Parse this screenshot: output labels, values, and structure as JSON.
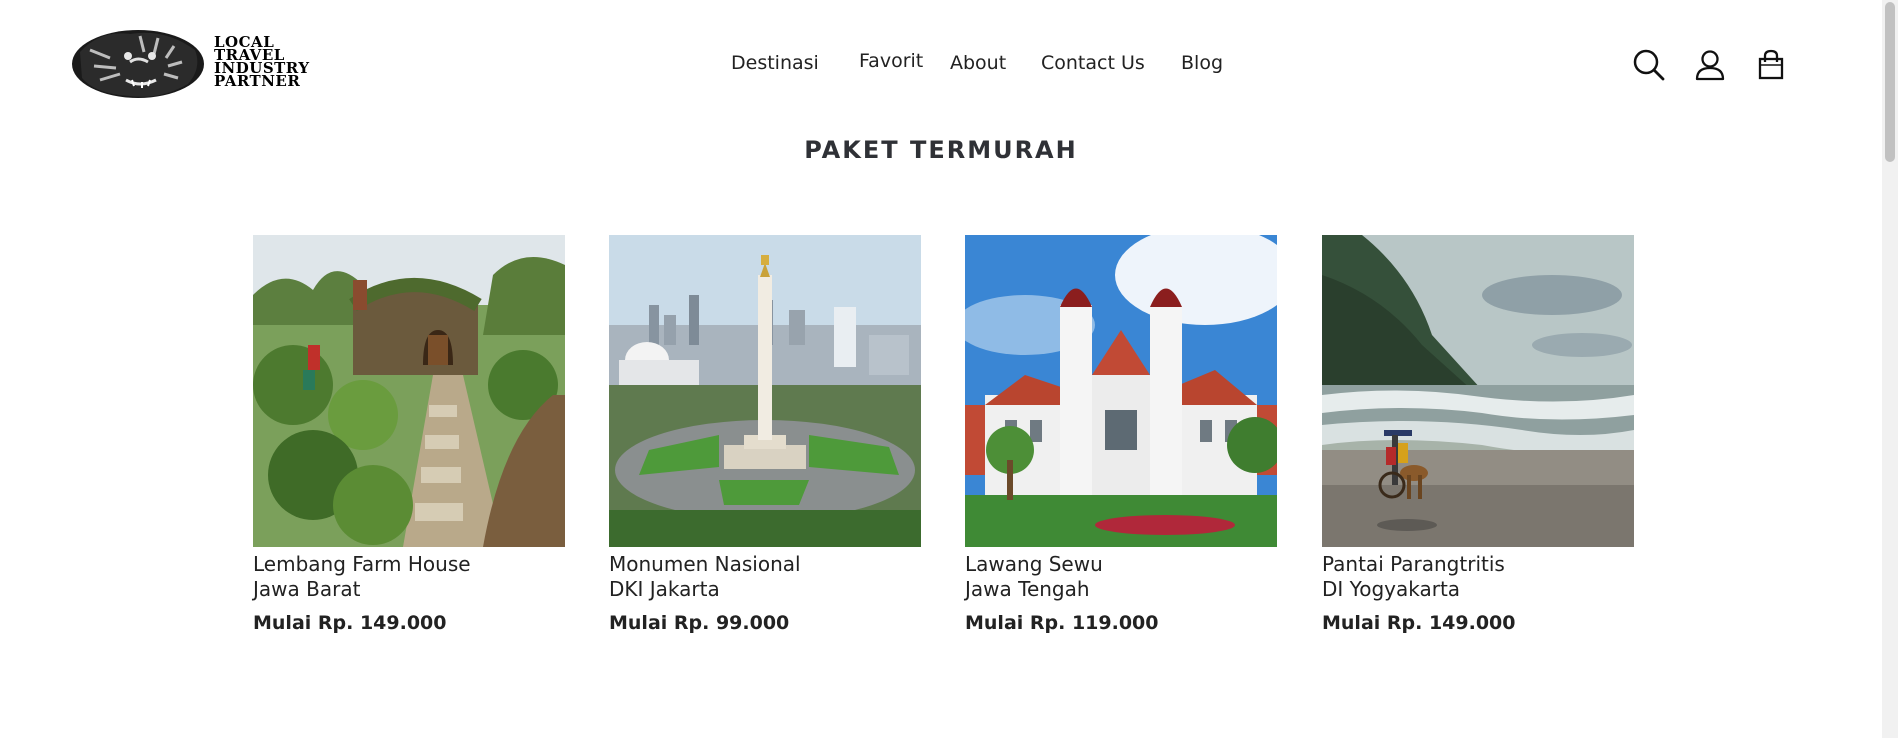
{
  "brand": {
    "logo_lines": [
      "LOCAL",
      "TRAVEL",
      "INDUSTRY",
      "PARTNER"
    ]
  },
  "nav": {
    "items": [
      "Destinasi",
      "Favorit",
      "About",
      "Contact Us",
      "Blog"
    ]
  },
  "header_icons": [
    "search-icon",
    "user-icon",
    "shopping-bag-icon"
  ],
  "section": {
    "title": "PAKET TERMURAH"
  },
  "packages": [
    {
      "name": "Lembang Farm House",
      "region": "Jawa Barat",
      "price": "Mulai Rp. 149.000",
      "image": "hobbit-house-garden"
    },
    {
      "name": "Monumen Nasional",
      "region": "DKI Jakarta",
      "price": "Mulai Rp. 99.000",
      "image": "monas-monument"
    },
    {
      "name": "Lawang Sewu",
      "region": "Jawa Tengah",
      "price": "Mulai Rp. 119.000",
      "image": "colonial-building"
    },
    {
      "name": "Pantai Parangtritis",
      "region": "DI Yogyakarta",
      "price": "Mulai Rp. 149.000",
      "image": "beach-horse-cart"
    }
  ],
  "colors": {
    "text": "#222222",
    "title": "#2f3136",
    "background": "#ffffff"
  }
}
